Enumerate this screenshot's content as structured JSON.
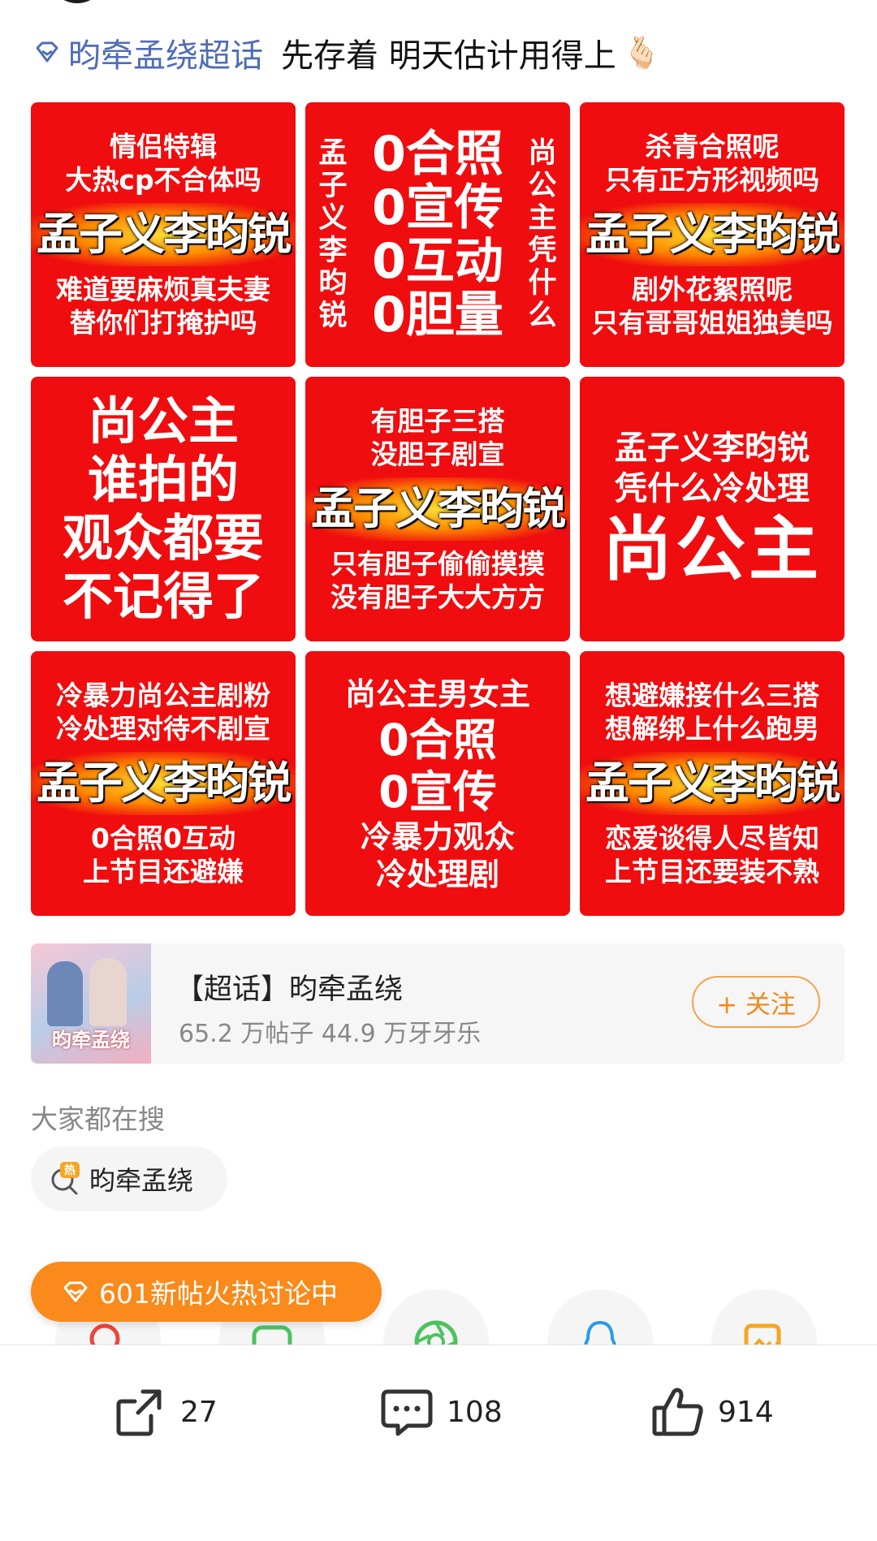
{
  "post": {
    "topic_link": "昀牵孟绕超话",
    "text": "先存着 明天估计用得上",
    "emoji": "🫰🏻"
  },
  "grid": {
    "c1": {
      "top1": "情侣特辑",
      "top2": "大热cp不合体吗",
      "name": "孟子义李昀锐",
      "bottom1": "难道要麻烦真夫妻",
      "bottom2": "替你们打掩护吗"
    },
    "c2": {
      "left": [
        "孟",
        "子",
        "义",
        "李",
        "昀",
        "锐"
      ],
      "center": [
        "0合照",
        "0宣传",
        "0互动",
        "0胆量"
      ],
      "right": [
        "尚",
        "公",
        "主",
        "凭",
        "什",
        "么"
      ]
    },
    "c3": {
      "top1": "杀青合照呢",
      "top2": "只有正方形视频吗",
      "name": "孟子义李昀锐",
      "bottom1": "剧外花絮照呢",
      "bottom2": "只有哥哥姐姐独美吗"
    },
    "c4": {
      "lines": [
        "尚公主",
        "谁拍的",
        "观众都要",
        "不记得了"
      ]
    },
    "c5": {
      "top1": "有胆子三搭",
      "top2": "没胆子剧宣",
      "name": "孟子义李昀锐",
      "bottom1": "只有胆子偷偷摸摸",
      "bottom2": "没有胆子大大方方"
    },
    "c6": {
      "top1": "孟子义李昀锐",
      "top2": "凭什么冷处理",
      "big": "尚公主"
    },
    "c7": {
      "top1": "冷暴力尚公主剧粉",
      "top2": "冷处理对待不剧宣",
      "name": "孟子义李昀锐",
      "bottom1": "0合照0互动",
      "bottom2": "上节目还避嫌"
    },
    "c8": {
      "top": "尚公主男女主",
      "mid1": "0合照",
      "mid2": "0宣传",
      "bottom1": "冷暴力观众",
      "bottom2": "冷处理剧"
    },
    "c9": {
      "top1": "想避嫌接什么三搭",
      "top2": "想解绑上什么跑男",
      "name": "孟子义李昀锐",
      "bottom1": "恋爱谈得人尽皆知",
      "bottom2": "上节目还要装不熟"
    }
  },
  "topic_card": {
    "name": "【超话】昀牵孟绕",
    "stats": "65.2 万帖子  44.9 万牙牙乐",
    "follow_label": "+ 关注",
    "cover_text": "昀牵孟绕"
  },
  "search": {
    "heading": "大家都在搜",
    "chip_label": "昀牵孟绕",
    "hot_tag": "热"
  },
  "hot_banner": {
    "label": "601新帖火热讨论中"
  },
  "share_icons": [
    "search-icon",
    "chat-icon",
    "aperture-icon",
    "qq-icon",
    "save-image-icon"
  ],
  "actions": {
    "repost_count": "27",
    "comment_count": "108",
    "like_count": "914"
  },
  "colors": {
    "cell_red": "#ef0d0f",
    "topic_blue": "#4f6cb6",
    "accent_orange": "#f98a1b",
    "aperture_green": "#4cc35e",
    "qq_blue": "#2d9ae8",
    "save_orange": "#f5a623"
  }
}
